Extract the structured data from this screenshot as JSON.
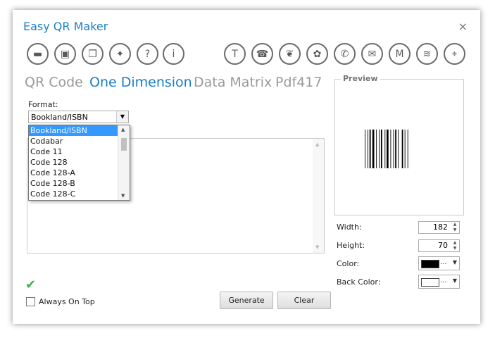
{
  "window": {
    "title": "Easy QR Maker",
    "close": "×"
  },
  "toolbar": [
    {
      "name": "open-folder-icon",
      "glyph": "▬"
    },
    {
      "name": "save-icon",
      "glyph": "▣"
    },
    {
      "name": "copy-icon",
      "glyph": "❐"
    },
    {
      "name": "twitter-icon",
      "glyph": "✦"
    },
    {
      "name": "help-icon",
      "glyph": "?"
    },
    {
      "name": "info-icon",
      "glyph": "i"
    },
    {
      "name": "text-icon",
      "glyph": "T"
    },
    {
      "name": "contact-icon",
      "glyph": "☎"
    },
    {
      "name": "bird-icon",
      "glyph": "❦"
    },
    {
      "name": "map-icon",
      "glyph": "✿"
    },
    {
      "name": "phone-icon",
      "glyph": "✆"
    },
    {
      "name": "sms-icon",
      "glyph": "✉"
    },
    {
      "name": "gmail-icon",
      "glyph": "M"
    },
    {
      "name": "wifi-icon",
      "glyph": "≋"
    },
    {
      "name": "location-icon",
      "glyph": "⌖"
    }
  ],
  "tabs": [
    "QR Code",
    "One Dimension",
    "Data Matrix",
    "Pdf417"
  ],
  "active_tab": "One Dimension",
  "format": {
    "label": "Format:",
    "selected": "Bookland/ISBN",
    "options": [
      "Bookland/ISBN",
      "Codabar",
      "Code 11",
      "Code 128",
      "Code 128-A",
      "Code 128-B",
      "Code 128-C"
    ]
  },
  "options": {
    "always_on_top": "Always On Top"
  },
  "buttons": {
    "generate": "Generate",
    "clear": "Clear"
  },
  "preview": {
    "legend": "Preview"
  },
  "properties": {
    "width_label": "Width:",
    "width_value": "182",
    "height_label": "Height:",
    "height_value": "70",
    "color_label": "Color:",
    "color_value": "#000000",
    "back_color_label": "Back Color:",
    "back_color_value": "#ffffff",
    "ellipsis": "..."
  }
}
